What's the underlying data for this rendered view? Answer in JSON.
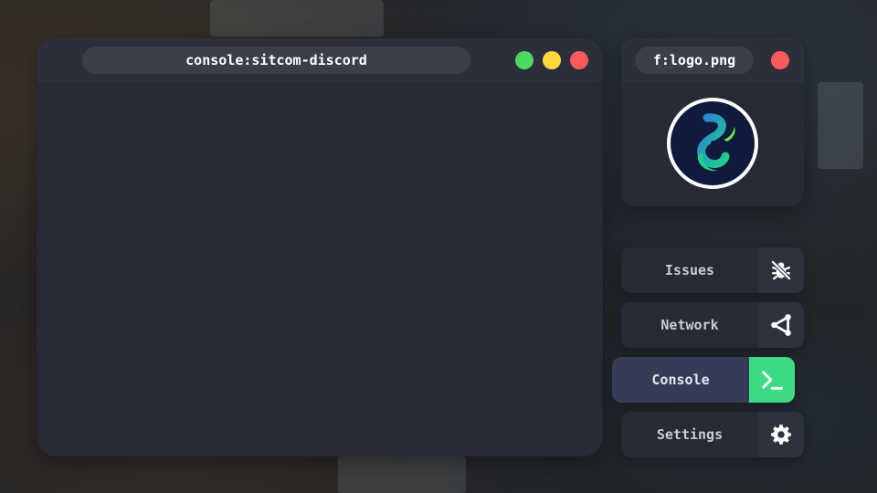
{
  "console_window": {
    "title": "console:sitcom-discord",
    "controls": {
      "maximize_color": "#4cd964",
      "minimize_color": "#ffd93d",
      "close_color": "#ff5a5a"
    }
  },
  "file_window": {
    "title": "f:logo.png",
    "close_color": "#ff5a5a",
    "image": "logo-image"
  },
  "nav": {
    "items": [
      {
        "label": "Issues",
        "icon": "bug-icon"
      },
      {
        "label": "Network",
        "icon": "network-icon"
      },
      {
        "label": "Console",
        "icon": "terminal-icon",
        "active": true
      },
      {
        "label": "Settings",
        "icon": "gear-icon"
      }
    ],
    "active_color": "#3ddc84"
  }
}
